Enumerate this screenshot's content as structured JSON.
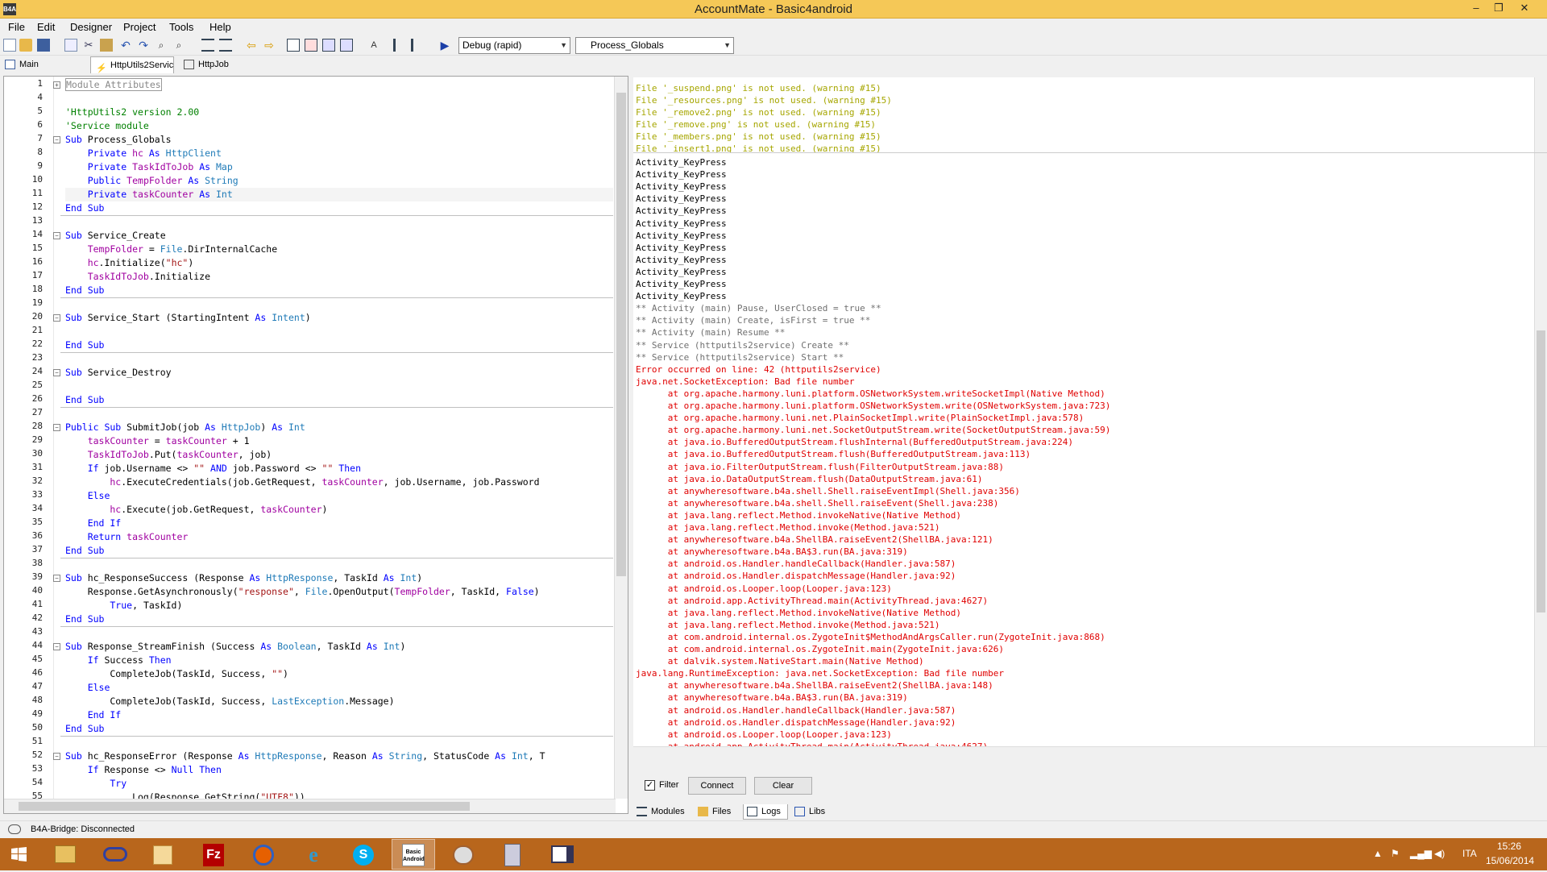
{
  "window": {
    "title": "AccountMate - Basic4android",
    "app_icon": "B4A",
    "min": "–",
    "max": "❐",
    "close": "✕"
  },
  "menu": [
    "File",
    "Edit",
    "Designer",
    "Project",
    "Tools",
    "Help"
  ],
  "toolbar": {
    "build_mode": "Debug (rapid)",
    "sub_select": "Process_Globals"
  },
  "tabs": [
    "Main",
    "HttpUtils2Servic",
    "HttpJob"
  ],
  "code_lines": [
    {
      "n": "1",
      "fold": "+",
      "t": "Module Attributes",
      "c": "com"
    },
    {
      "n": "4",
      "t": ""
    },
    {
      "n": "5",
      "t": "'HttpUtils2 version 2.00",
      "c": "com"
    },
    {
      "n": "6",
      "t": "'Service module",
      "c": "com"
    },
    {
      "n": "7",
      "fold": "−",
      "t": "Sub Process_Globals",
      "c": "mix",
      "parts": [
        [
          "Sub ",
          "kw"
        ],
        [
          "Process_Globals",
          "ct"
        ]
      ]
    },
    {
      "n": "8",
      "t": "    Private hc As HttpClient",
      "parts": [
        [
          "    Private ",
          "kw"
        ],
        [
          "hc ",
          "var"
        ],
        [
          "As ",
          "kw"
        ],
        [
          "HttpClient",
          "typ"
        ]
      ]
    },
    {
      "n": "9",
      "t": "    Private TaskIdToJob As Map",
      "parts": [
        [
          "    Private ",
          "kw"
        ],
        [
          "TaskIdToJob ",
          "var"
        ],
        [
          "As ",
          "kw"
        ],
        [
          "Map",
          "typ"
        ]
      ]
    },
    {
      "n": "10",
      "t": "    Public TempFolder As String",
      "parts": [
        [
          "    Public ",
          "kw"
        ],
        [
          "TempFolder ",
          "var"
        ],
        [
          "As ",
          "kw"
        ],
        [
          "String",
          "typ"
        ]
      ]
    },
    {
      "n": "11",
      "t": "    Private taskCounter As Int",
      "parts": [
        [
          "    Private ",
          "kw"
        ],
        [
          "taskCounter ",
          "var"
        ],
        [
          "As ",
          "kw"
        ],
        [
          "Int",
          "typ"
        ]
      ]
    },
    {
      "n": "12",
      "t": "End Sub",
      "parts": [
        [
          "End Sub",
          "kw"
        ]
      ]
    },
    {
      "n": "13",
      "t": ""
    },
    {
      "n": "14",
      "fold": "−",
      "t": "Sub Service_Create",
      "parts": [
        [
          "Sub ",
          "kw"
        ],
        [
          "Service_Create",
          "ct"
        ]
      ]
    },
    {
      "n": "15",
      "t": "    TempFolder = File.DirInternalCache",
      "parts": [
        [
          "    TempFolder",
          "var"
        ],
        [
          " = ",
          "ct"
        ],
        [
          "File",
          "typ"
        ],
        [
          ".DirInternalCache",
          "ct"
        ]
      ]
    },
    {
      "n": "16",
      "t": "    hc.Initialize(\"hc\")",
      "parts": [
        [
          "    hc",
          "var"
        ],
        [
          ".Initialize(",
          "ct"
        ],
        [
          "\"hc\"",
          "str"
        ],
        [
          ")",
          "ct"
        ]
      ]
    },
    {
      "n": "17",
      "t": "    TaskIdToJob.Initialize",
      "parts": [
        [
          "    TaskIdToJob",
          "var"
        ],
        [
          ".Initialize",
          "ct"
        ]
      ]
    },
    {
      "n": "18",
      "t": "End Sub",
      "parts": [
        [
          "End Sub",
          "kw"
        ]
      ]
    },
    {
      "n": "19",
      "t": ""
    },
    {
      "n": "20",
      "fold": "−",
      "t": "Sub Service_Start (StartingIntent As Intent)",
      "parts": [
        [
          "Sub ",
          "kw"
        ],
        [
          "Service_Start (StartingIntent ",
          "ct"
        ],
        [
          "As ",
          "kw"
        ],
        [
          "Intent",
          "typ"
        ],
        [
          ")",
          "ct"
        ]
      ]
    },
    {
      "n": "21",
      "t": ""
    },
    {
      "n": "22",
      "t": "End Sub",
      "parts": [
        [
          "End Sub",
          "kw"
        ]
      ]
    },
    {
      "n": "23",
      "t": ""
    },
    {
      "n": "24",
      "fold": "−",
      "t": "Sub Service_Destroy",
      "parts": [
        [
          "Sub ",
          "kw"
        ],
        [
          "Service_Destroy",
          "ct"
        ]
      ]
    },
    {
      "n": "25",
      "t": ""
    },
    {
      "n": "26",
      "t": "End Sub",
      "parts": [
        [
          "End Sub",
          "kw"
        ]
      ]
    },
    {
      "n": "27",
      "t": ""
    },
    {
      "n": "28",
      "fold": "−",
      "t": "Public Sub SubmitJob(job As HttpJob) As Int",
      "parts": [
        [
          "Public Sub ",
          "kw"
        ],
        [
          "SubmitJob(job ",
          "ct"
        ],
        [
          "As ",
          "kw"
        ],
        [
          "HttpJob",
          "typ"
        ],
        [
          ") ",
          "ct"
        ],
        [
          "As ",
          "kw"
        ],
        [
          "Int",
          "typ"
        ]
      ]
    },
    {
      "n": "29",
      "t": "    taskCounter = taskCounter + 1",
      "parts": [
        [
          "    taskCounter",
          "var"
        ],
        [
          " = ",
          "ct"
        ],
        [
          "taskCounter",
          "var"
        ],
        [
          " + 1",
          "ct"
        ]
      ]
    },
    {
      "n": "30",
      "t": "    TaskIdToJob.Put(taskCounter, job)",
      "parts": [
        [
          "    TaskIdToJob",
          "var"
        ],
        [
          ".Put(",
          "ct"
        ],
        [
          "taskCounter",
          "var"
        ],
        [
          ", job)",
          "ct"
        ]
      ]
    },
    {
      "n": "31",
      "t": "    If job.Username <> \"\" AND job.Password <> \"\" Then",
      "parts": [
        [
          "    If ",
          "kw"
        ],
        [
          "job.Username <> ",
          "ct"
        ],
        [
          "\"\" ",
          "str"
        ],
        [
          "AND ",
          "kw"
        ],
        [
          "job.Password <> ",
          "ct"
        ],
        [
          "\"\" ",
          "str"
        ],
        [
          "Then",
          "kw"
        ]
      ]
    },
    {
      "n": "32",
      "t": "        hc.ExecuteCredentials(job.GetRequest, taskCounter, job.Username, job.Password",
      "parts": [
        [
          "        hc",
          "var"
        ],
        [
          ".ExecuteCredentials(job.GetRequest, ",
          "ct"
        ],
        [
          "taskCounter",
          "var"
        ],
        [
          ", job.Username, job.Password",
          "ct"
        ]
      ]
    },
    {
      "n": "33",
      "t": "    Else",
      "parts": [
        [
          "    Else",
          "kw"
        ]
      ]
    },
    {
      "n": "34",
      "t": "        hc.Execute(job.GetRequest, taskCounter)",
      "parts": [
        [
          "        hc",
          "var"
        ],
        [
          ".Execute(job.GetRequest, ",
          "ct"
        ],
        [
          "taskCounter",
          "var"
        ],
        [
          ")",
          "ct"
        ]
      ]
    },
    {
      "n": "35",
      "t": "    End If",
      "parts": [
        [
          "    End If",
          "kw"
        ]
      ]
    },
    {
      "n": "36",
      "t": "    Return taskCounter",
      "parts": [
        [
          "    Return ",
          "kw"
        ],
        [
          "taskCounter",
          "var"
        ]
      ]
    },
    {
      "n": "37",
      "t": "End Sub",
      "parts": [
        [
          "End Sub",
          "kw"
        ]
      ]
    },
    {
      "n": "38",
      "t": ""
    },
    {
      "n": "39",
      "fold": "−",
      "t": "Sub hc_ResponseSuccess (Response As HttpResponse, TaskId As Int)",
      "parts": [
        [
          "Sub ",
          "kw"
        ],
        [
          "hc_ResponseSuccess (Response ",
          "ct"
        ],
        [
          "As ",
          "kw"
        ],
        [
          "HttpResponse",
          "typ"
        ],
        [
          ", TaskId ",
          "ct"
        ],
        [
          "As ",
          "kw"
        ],
        [
          "Int",
          "typ"
        ],
        [
          ")",
          "ct"
        ]
      ]
    },
    {
      "n": "40",
      "t": "    Response.GetAsynchronously(\"response\", File.OpenOutput(TempFolder, TaskId, False)",
      "parts": [
        [
          "    Response.GetAsynchronously(",
          "ct"
        ],
        [
          "\"response\"",
          "str"
        ],
        [
          ", ",
          "ct"
        ],
        [
          "File",
          "typ"
        ],
        [
          ".OpenOutput(",
          "ct"
        ],
        [
          "TempFolder",
          "var"
        ],
        [
          ", TaskId, ",
          "ct"
        ],
        [
          "False",
          "kw"
        ],
        [
          ")",
          "ct"
        ]
      ]
    },
    {
      "n": "41",
      "t": "        True, TaskId)",
      "parts": [
        [
          "        True",
          "kw"
        ],
        [
          ", TaskId)",
          "ct"
        ]
      ]
    },
    {
      "n": "42",
      "t": "End Sub",
      "parts": [
        [
          "End Sub",
          "kw"
        ]
      ]
    },
    {
      "n": "43",
      "t": ""
    },
    {
      "n": "44",
      "fold": "−",
      "t": "Sub Response_StreamFinish (Success As Boolean, TaskId As Int)",
      "parts": [
        [
          "Sub ",
          "kw"
        ],
        [
          "Response_StreamFinish (Success ",
          "ct"
        ],
        [
          "As ",
          "kw"
        ],
        [
          "Boolean",
          "typ"
        ],
        [
          ", TaskId ",
          "ct"
        ],
        [
          "As ",
          "kw"
        ],
        [
          "Int",
          "typ"
        ],
        [
          ")",
          "ct"
        ]
      ]
    },
    {
      "n": "45",
      "t": "    If Success Then",
      "parts": [
        [
          "    If ",
          "kw"
        ],
        [
          "Success ",
          "ct"
        ],
        [
          "Then",
          "kw"
        ]
      ]
    },
    {
      "n": "46",
      "t": "        CompleteJob(TaskId, Success, \"\")",
      "parts": [
        [
          "        CompleteJob(TaskId, Success, ",
          "ct"
        ],
        [
          "\"\"",
          "str"
        ],
        [
          ")",
          "ct"
        ]
      ]
    },
    {
      "n": "47",
      "t": "    Else",
      "parts": [
        [
          "    Else",
          "kw"
        ]
      ]
    },
    {
      "n": "48",
      "t": "        CompleteJob(TaskId, Success, LastException.Message)",
      "parts": [
        [
          "        CompleteJob(TaskId, Success, ",
          "ct"
        ],
        [
          "LastException",
          "typ"
        ],
        [
          ".Message)",
          "ct"
        ]
      ]
    },
    {
      "n": "49",
      "t": "    End If",
      "parts": [
        [
          "    End If",
          "kw"
        ]
      ]
    },
    {
      "n": "50",
      "t": "End Sub",
      "parts": [
        [
          "End Sub",
          "kw"
        ]
      ]
    },
    {
      "n": "51",
      "t": ""
    },
    {
      "n": "52",
      "fold": "−",
      "t": "Sub hc_ResponseError (Response As HttpResponse, Reason As String, StatusCode As Int, T",
      "parts": [
        [
          "Sub ",
          "kw"
        ],
        [
          "hc_ResponseError (Response ",
          "ct"
        ],
        [
          "As ",
          "kw"
        ],
        [
          "HttpResponse",
          "typ"
        ],
        [
          ", Reason ",
          "ct"
        ],
        [
          "As ",
          "kw"
        ],
        [
          "String",
          "typ"
        ],
        [
          ", StatusCode ",
          "ct"
        ],
        [
          "As ",
          "kw"
        ],
        [
          "Int",
          "typ"
        ],
        [
          ", T",
          "ct"
        ]
      ]
    },
    {
      "n": "53",
      "t": "    If Response <> Null Then",
      "parts": [
        [
          "    If ",
          "kw"
        ],
        [
          "Response <> ",
          "ct"
        ],
        [
          "Null ",
          "kw"
        ],
        [
          "Then",
          "kw"
        ]
      ]
    },
    {
      "n": "54",
      "t": "        Try",
      "parts": [
        [
          "        Try",
          "kw"
        ]
      ]
    },
    {
      "n": "55",
      "t": "            Log(Response.GetString(\"UTF8\"))",
      "parts": [
        [
          "            Log(Response.GetString(",
          "ct"
        ],
        [
          "\"UTF8\"",
          "str"
        ],
        [
          "))",
          "ct"
        ]
      ]
    }
  ],
  "warnings": [
    "File '_suspend.png' is not used. (warning #15)",
    "File '_resources.png' is not used. (warning #15)",
    "File '_remove2.png' is not used. (warning #15)",
    "File '_remove.png' is not used. (warning #15)",
    "File '_members.png' is not used. (warning #15)",
    "File '_insert1.png' is not used. (warning #15)"
  ],
  "logs": [
    [
      "Activity_KeyPress",
      "b"
    ],
    [
      "Activity_KeyPress",
      "b"
    ],
    [
      "Activity_KeyPress",
      "b"
    ],
    [
      "Activity_KeyPress",
      "b"
    ],
    [
      "Activity_KeyPress",
      "b"
    ],
    [
      "Activity_KeyPress",
      "b"
    ],
    [
      "Activity_KeyPress",
      "b"
    ],
    [
      "Activity_KeyPress",
      "b"
    ],
    [
      "Activity_KeyPress",
      "b"
    ],
    [
      "Activity_KeyPress",
      "b"
    ],
    [
      "Activity_KeyPress",
      "b"
    ],
    [
      "Activity_KeyPress",
      "b"
    ],
    [
      "** Activity (main) Pause, UserClosed = true **",
      "g"
    ],
    [
      "** Activity (main) Create, isFirst = true **",
      "g"
    ],
    [
      "** Activity (main) Resume **",
      "g"
    ],
    [
      "** Service (httputils2service) Create **",
      "g"
    ],
    [
      "** Service (httputils2service) Start **",
      "g"
    ],
    [
      "Error occurred on line: 42 (httputils2service)",
      "r"
    ],
    [
      "java.net.SocketException: Bad file number",
      "r"
    ],
    [
      "      at org.apache.harmony.luni.platform.OSNetworkSystem.writeSocketImpl(Native Method)",
      "r"
    ],
    [
      "      at org.apache.harmony.luni.platform.OSNetworkSystem.write(OSNetworkSystem.java:723)",
      "r"
    ],
    [
      "      at org.apache.harmony.luni.net.PlainSocketImpl.write(PlainSocketImpl.java:578)",
      "r"
    ],
    [
      "      at org.apache.harmony.luni.net.SocketOutputStream.write(SocketOutputStream.java:59)",
      "r"
    ],
    [
      "      at java.io.BufferedOutputStream.flushInternal(BufferedOutputStream.java:224)",
      "r"
    ],
    [
      "      at java.io.BufferedOutputStream.flush(BufferedOutputStream.java:113)",
      "r"
    ],
    [
      "      at java.io.FilterOutputStream.flush(FilterOutputStream.java:88)",
      "r"
    ],
    [
      "      at java.io.DataOutputStream.flush(DataOutputStream.java:61)",
      "r"
    ],
    [
      "      at anywheresoftware.b4a.shell.Shell.raiseEventImpl(Shell.java:356)",
      "r"
    ],
    [
      "      at anywheresoftware.b4a.shell.Shell.raiseEvent(Shell.java:238)",
      "r"
    ],
    [
      "      at java.lang.reflect.Method.invokeNative(Native Method)",
      "r"
    ],
    [
      "      at java.lang.reflect.Method.invoke(Method.java:521)",
      "r"
    ],
    [
      "      at anywheresoftware.b4a.ShellBA.raiseEvent2(ShellBA.java:121)",
      "r"
    ],
    [
      "      at anywheresoftware.b4a.BA$3.run(BA.java:319)",
      "r"
    ],
    [
      "      at android.os.Handler.handleCallback(Handler.java:587)",
      "r"
    ],
    [
      "      at android.os.Handler.dispatchMessage(Handler.java:92)",
      "r"
    ],
    [
      "      at android.os.Looper.loop(Looper.java:123)",
      "r"
    ],
    [
      "      at android.app.ActivityThread.main(ActivityThread.java:4627)",
      "r"
    ],
    [
      "      at java.lang.reflect.Method.invokeNative(Native Method)",
      "r"
    ],
    [
      "      at java.lang.reflect.Method.invoke(Method.java:521)",
      "r"
    ],
    [
      "      at com.android.internal.os.ZygoteInit$MethodAndArgsCaller.run(ZygoteInit.java:868)",
      "r"
    ],
    [
      "      at com.android.internal.os.ZygoteInit.main(ZygoteInit.java:626)",
      "r"
    ],
    [
      "      at dalvik.system.NativeStart.main(Native Method)",
      "r"
    ],
    [
      "java.lang.RuntimeException: java.net.SocketException: Bad file number",
      "r"
    ],
    [
      "      at anywheresoftware.b4a.ShellBA.raiseEvent2(ShellBA.java:148)",
      "r"
    ],
    [
      "      at anywheresoftware.b4a.BA$3.run(BA.java:319)",
      "r"
    ],
    [
      "      at android.os.Handler.handleCallback(Handler.java:587)",
      "r"
    ],
    [
      "      at android.os.Handler.dispatchMessage(Handler.java:92)",
      "r"
    ],
    [
      "      at android.os.Looper.loop(Looper.java:123)",
      "r"
    ],
    [
      "      at android.app.ActivityThread.main(ActivityThread.java:4627)",
      "r"
    ]
  ],
  "filter": {
    "label": "Filter",
    "connect": "Connect",
    "clear": "Clear"
  },
  "bottom_tabs": [
    "Modules",
    "Files",
    "Logs",
    "Libs"
  ],
  "status": {
    "bridge": "B4A-Bridge: Disconnected"
  },
  "tray": {
    "lang": "ITA",
    "time": "15:26",
    "date": "15/06/2014"
  },
  "colors": {
    "keyword": "#0000ff",
    "string": "#a31515",
    "comment": "#008000",
    "variable": "#a000a0",
    "type": "#1e7ab7",
    "warning": "#a6a600",
    "error": "#e00000",
    "log_gray": "#707070",
    "taskbar": "#b8661c",
    "titlebar": "#f5c857"
  }
}
